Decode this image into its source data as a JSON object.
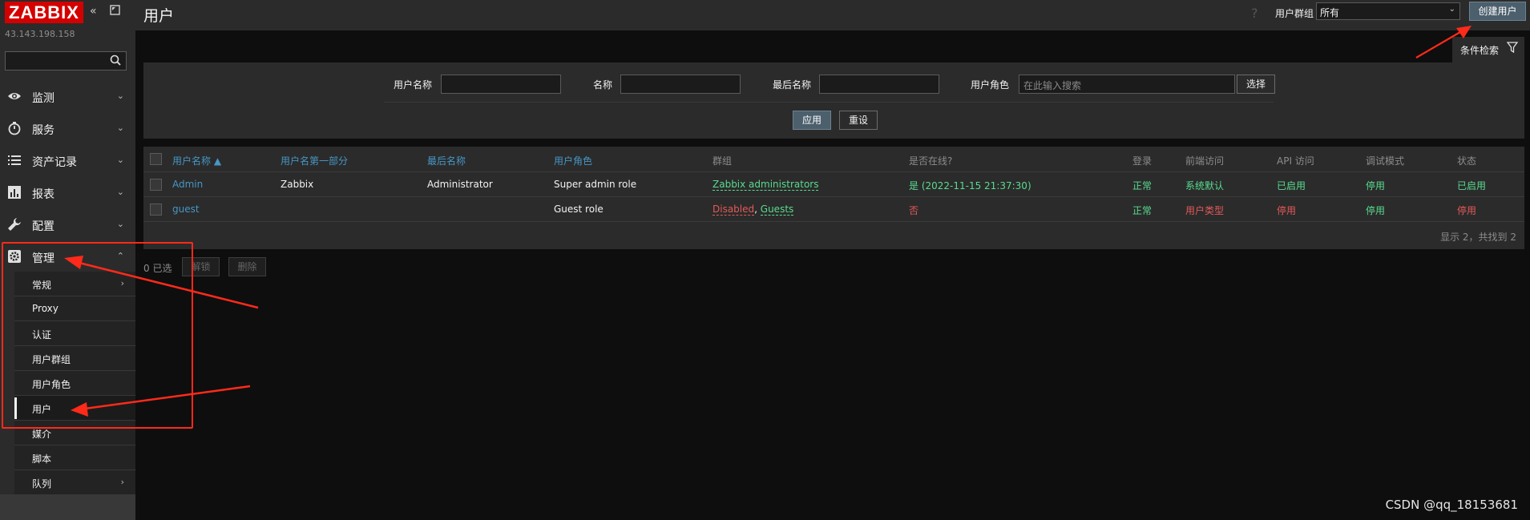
{
  "sidebar": {
    "logo": "ZABBIX",
    "server": "43.143.198.158",
    "menu": [
      {
        "label": "监测",
        "icon": "eye-icon"
      },
      {
        "label": "服务",
        "icon": "stopwatch-icon"
      },
      {
        "label": "资产记录",
        "icon": "list-icon"
      },
      {
        "label": "报表",
        "icon": "bar-chart-icon"
      },
      {
        "label": "配置",
        "icon": "wrench-icon"
      },
      {
        "label": "管理",
        "icon": "gear-icon"
      }
    ],
    "submenu": [
      "常规",
      "Proxy",
      "认证",
      "用户群组",
      "用户角色",
      "用户",
      "媒介",
      "脚本",
      "队列"
    ]
  },
  "header": {
    "title": "用户",
    "help": "?",
    "group_label": "用户群组",
    "group_value": "所有",
    "create_button": "创建用户"
  },
  "filter": {
    "tab": "条件检索",
    "username_label": "用户名称",
    "name_label": "名称",
    "surname_label": "最后名称",
    "role_label": "用户角色",
    "role_placeholder": "在此输入搜索",
    "select_button": "选择",
    "apply_button": "应用",
    "reset_button": "重设"
  },
  "table": {
    "headers": [
      "用户名称 ▲",
      "用户名第一部分",
      "最后名称",
      "用户角色",
      "群组",
      "是否在线?",
      "登录",
      "前端访问",
      "API 访问",
      "调试模式",
      "状态"
    ],
    "rows": [
      {
        "alias": "Admin",
        "name": "Zabbix",
        "surname": "Administrator",
        "role": "Super admin role",
        "groups": "Zabbix administrators",
        "online": "是 (2022-11-15 21:37:30)",
        "login": "正常",
        "frontend": "系统默认",
        "api": "已启用",
        "debug": "停用",
        "status": "已启用"
      },
      {
        "alias": "guest",
        "name": "",
        "surname": "",
        "role": "Guest role",
        "group1": "Disabled",
        "group_sep": ", ",
        "group2": "Guests",
        "online": "否",
        "login": "正常",
        "frontend": "用户类型",
        "api": "停用",
        "debug": "停用",
        "status": "停用"
      }
    ],
    "footer": "显示 2，共找到 2"
  },
  "actions": {
    "selected": "0 已选",
    "unblock": "解锁",
    "delete": "删除"
  },
  "watermark": "CSDN @qq_18153681",
  "colors": {
    "brand": "#d40000",
    "link": "#4796c4",
    "green": "#59db8f",
    "red": "#e45959",
    "annotation": "#ff2a1a"
  }
}
